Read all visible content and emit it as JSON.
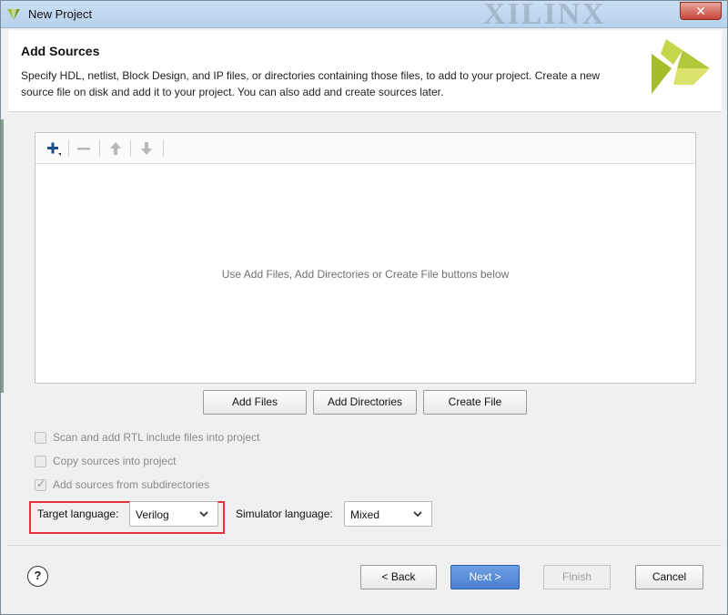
{
  "window": {
    "title": "New Project",
    "watermark": "XILINX",
    "close_glyph": "✕"
  },
  "header": {
    "title": "Add Sources",
    "description": "Specify HDL, netlist, Block Design, and IP files, or directories containing those files, to add to your project. Create a new source file on disk and add it to your project. You can also add and create sources later."
  },
  "toolbar": {
    "add_icon": "plus-icon",
    "remove_icon": "minus-icon",
    "up_icon": "arrow-up-icon",
    "down_icon": "arrow-down-icon"
  },
  "file_panel": {
    "empty_message": "Use Add Files, Add Directories or Create File buttons below"
  },
  "actions": {
    "add_files": "Add Files",
    "add_directories": "Add Directories",
    "create_file": "Create File"
  },
  "options": {
    "scan_rtl": "Scan and add RTL include files into project",
    "copy_sources": "Copy sources into project",
    "add_subdirs": "Add sources from subdirectories",
    "add_subdirs_checked": true
  },
  "language": {
    "target_label": "Target language:",
    "target_value": "Verilog",
    "simulator_label": "Simulator language:",
    "simulator_value": "Mixed"
  },
  "footer": {
    "help": "?",
    "back": "< Back",
    "next": "Next >",
    "finish": "Finish",
    "cancel": "Cancel"
  },
  "colors": {
    "highlight": "#e0333d",
    "primary_button": "#4b7fd1",
    "logo_green": "#a9c23f"
  }
}
